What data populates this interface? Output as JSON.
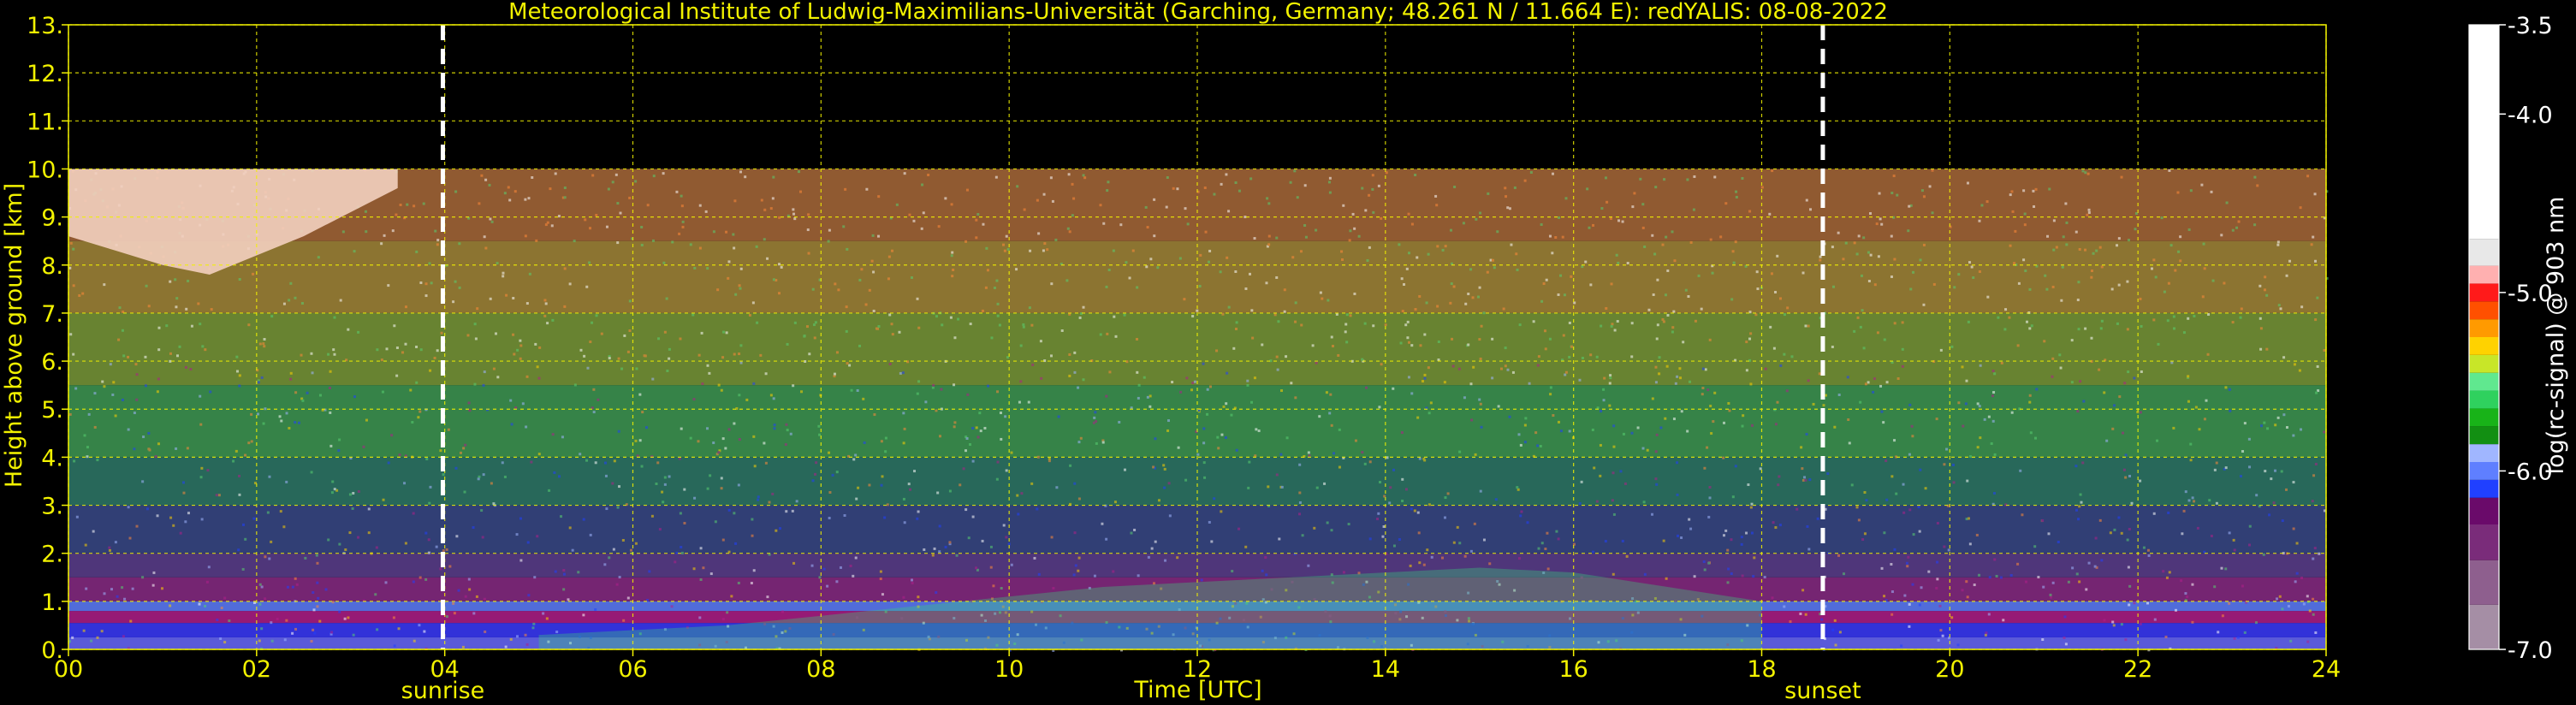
{
  "chart_data": {
    "type": "heatmap",
    "title": "Meteorological Institute of Ludwig-Maximilians-Universität (Garching, Germany; 48.261 N / 11.664 E):    redYALIS: 08-08-2022",
    "xlabel": "Time [UTC]",
    "ylabel": "Height above ground [km]",
    "xlim": [
      0,
      24
    ],
    "ylim": [
      0,
      13
    ],
    "x_ticks": [
      "00",
      "02",
      "04",
      "06",
      "08",
      "10",
      "12",
      "14",
      "16",
      "18",
      "20",
      "22",
      "24"
    ],
    "y_ticks": [
      "0.",
      "1.",
      "2.",
      "3.",
      "4.",
      "5.",
      "6.",
      "7.",
      "8.",
      "9.",
      "10.",
      "11.",
      "12.",
      "13."
    ],
    "grid": true,
    "data_top_km": 10,
    "events": [
      {
        "label": "sunrise",
        "time": 3.98
      },
      {
        "label": "sunset",
        "time": 18.65
      }
    ],
    "colorbar": {
      "label": "log(rc-signal) @ 903 nm",
      "range": [
        -7.0,
        -3.5
      ],
      "ticks": [
        "-3.5",
        "-4.0",
        "-5.0",
        "-6.0",
        "-7.0"
      ],
      "tick_values": [
        -3.5,
        -4.0,
        -5.0,
        -6.0,
        -7.0
      ],
      "bands": [
        {
          "from": -7.0,
          "to": -6.75,
          "color": "#a58ea5"
        },
        {
          "from": -6.75,
          "to": -6.5,
          "color": "#8e5f8e"
        },
        {
          "from": -6.5,
          "to": -6.3,
          "color": "#7a2c7a"
        },
        {
          "from": -6.3,
          "to": -6.15,
          "color": "#6a0a6a"
        },
        {
          "from": -6.15,
          "to": -6.05,
          "color": "#2040ff"
        },
        {
          "from": -6.05,
          "to": -5.95,
          "color": "#5f7fff"
        },
        {
          "from": -5.95,
          "to": -5.85,
          "color": "#a0b6ff"
        },
        {
          "from": -5.85,
          "to": -5.75,
          "color": "#128f12"
        },
        {
          "from": -5.75,
          "to": -5.65,
          "color": "#18b318"
        },
        {
          "from": -5.65,
          "to": -5.55,
          "color": "#2fd15e"
        },
        {
          "from": -5.55,
          "to": -5.45,
          "color": "#60e88f"
        },
        {
          "from": -5.45,
          "to": -5.35,
          "color": "#c8e628"
        },
        {
          "from": -5.35,
          "to": -5.25,
          "color": "#ffd200"
        },
        {
          "from": -5.25,
          "to": -5.15,
          "color": "#ff9a00"
        },
        {
          "from": -5.15,
          "to": -5.05,
          "color": "#ff5000"
        },
        {
          "from": -5.05,
          "to": -4.95,
          "color": "#ff1a1a"
        },
        {
          "from": -4.95,
          "to": -4.85,
          "color": "#ffb0b0"
        },
        {
          "from": -4.85,
          "to": -4.7,
          "color": "#e8e8e8"
        },
        {
          "from": -4.7,
          "to": -3.5,
          "color": "#ffffff"
        }
      ]
    },
    "signal_profile": [
      {
        "from_km": 0.0,
        "to_km": 0.25,
        "color": "#6a6aff"
      },
      {
        "from_km": 0.25,
        "to_km": 0.55,
        "color": "#3b3bff"
      },
      {
        "from_km": 0.55,
        "to_km": 0.8,
        "color": "#b01f8a"
      },
      {
        "from_km": 0.8,
        "to_km": 1.0,
        "color": "#5f7fff"
      },
      {
        "from_km": 1.0,
        "to_km": 1.5,
        "color": "#8a2c86"
      },
      {
        "from_km": 1.5,
        "to_km": 2.0,
        "color": "#5d3f8f"
      },
      {
        "from_km": 2.0,
        "to_km": 3.0,
        "color": "#3a4a8a"
      },
      {
        "from_km": 3.0,
        "to_km": 4.0,
        "color": "#2f7a6a"
      },
      {
        "from_km": 4.0,
        "to_km": 5.5,
        "color": "#3f9a55"
      },
      {
        "from_km": 5.5,
        "to_km": 7.0,
        "color": "#7a9a3a"
      },
      {
        "from_km": 7.0,
        "to_km": 8.5,
        "color": "#a5883a"
      },
      {
        "from_km": 8.5,
        "to_km": 10.0,
        "color": "#a96a3a"
      }
    ],
    "cloud": {
      "x": [
        0,
        0.5,
        1.0,
        1.5,
        2.0,
        2.5,
        3.0,
        3.5
      ],
      "base_km": [
        8.6,
        8.3,
        8.0,
        7.8,
        8.2,
        8.6,
        9.1,
        9.6
      ],
      "top_km": 10.0,
      "color": "#f3d0c0"
    },
    "boundary_layer": {
      "x": [
        5.0,
        6.0,
        7.0,
        8.0,
        9.0,
        10.0,
        11.0,
        12.0,
        13.0,
        14.0,
        15.0,
        16.0,
        17.0,
        18.0
      ],
      "top_km": [
        0.3,
        0.4,
        0.5,
        0.7,
        0.9,
        1.1,
        1.3,
        1.4,
        1.5,
        1.6,
        1.7,
        1.6,
        1.3,
        1.0
      ],
      "color": "#3ad17a"
    }
  }
}
